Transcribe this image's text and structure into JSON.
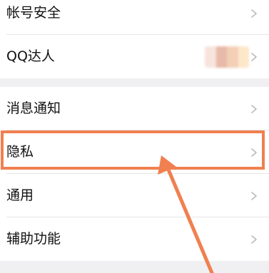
{
  "settings": {
    "group1": [
      {
        "label": "帐号安全"
      },
      {
        "label": "QQ达人"
      }
    ],
    "group2": [
      {
        "label": "消息通知"
      },
      {
        "label": "隐私"
      },
      {
        "label": "通用"
      },
      {
        "label": "辅助功能"
      }
    ]
  },
  "qq_daren_badge_colors": [
    "#f6e4dd",
    "#e7b9a8",
    "#f3cfb6",
    "#fde7c9"
  ],
  "annotation": {
    "color": "#f08050",
    "highlighted_item": "隐私"
  }
}
